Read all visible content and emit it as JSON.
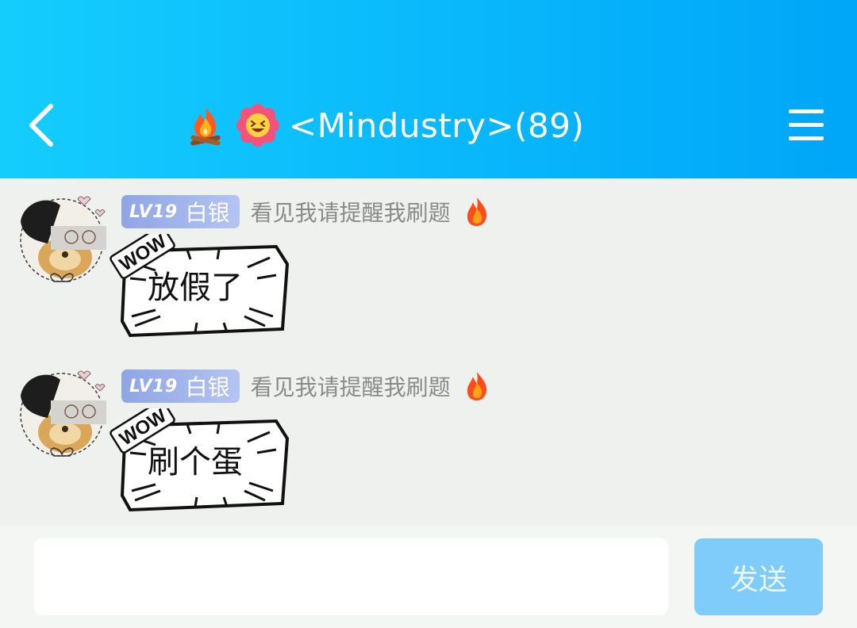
{
  "header": {
    "group_name": "<Mindustry>(89)",
    "icons": [
      "campfire-icon",
      "laughing-flower-icon"
    ],
    "colors": {
      "gradient_start": "#14cdfd",
      "gradient_end": "#00a6f8",
      "text": "#ffffff"
    }
  },
  "messages": [
    {
      "level": "LV19",
      "rank": "白银",
      "title": "看见我请提醒我刷题",
      "text": "放假了",
      "badge_icon": "fire-icon",
      "bubble_sticker": "WOW"
    },
    {
      "level": "LV19",
      "rank": "白银",
      "title": "看见我请提醒我刷题",
      "text": "刷个蛋",
      "badge_icon": "fire-icon",
      "bubble_sticker": "WOW"
    }
  ],
  "composer": {
    "input_value": "",
    "send_label": "发送",
    "send_color": "#7fccfb"
  }
}
